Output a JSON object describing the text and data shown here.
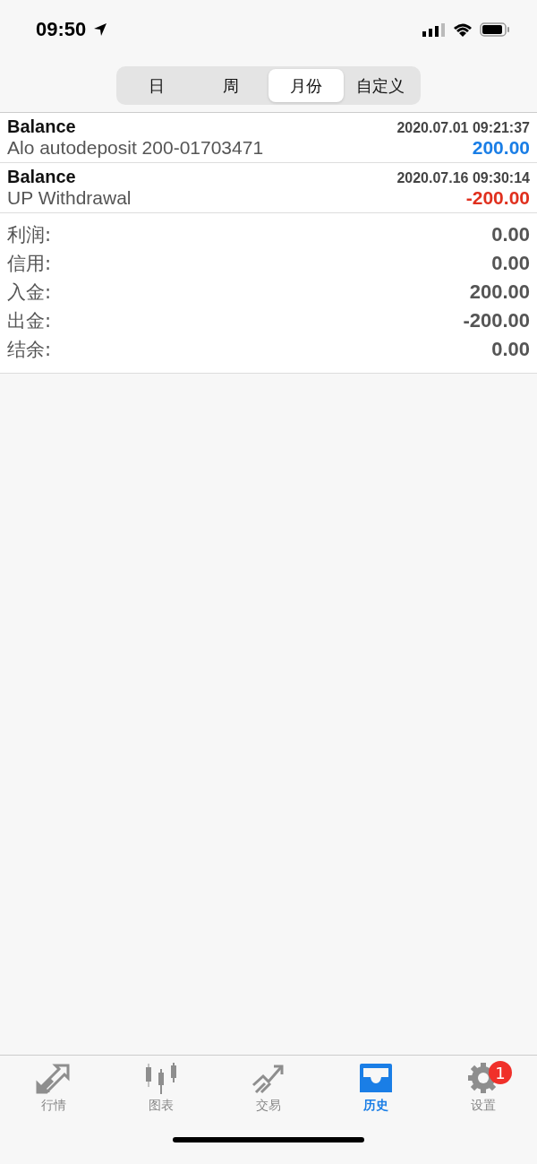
{
  "status_bar": {
    "time": "09:50"
  },
  "periods": [
    {
      "label": "日",
      "selected": false
    },
    {
      "label": "周",
      "selected": false
    },
    {
      "label": "月份",
      "selected": true
    },
    {
      "label": "自定义",
      "selected": false
    }
  ],
  "deals": [
    {
      "type": "Balance",
      "time": "2020.07.01 09:21:37",
      "comment": "Alo autodeposit 200-01703471",
      "amount": "200.00",
      "color": "#1a7ee6"
    },
    {
      "type": "Balance",
      "time": "2020.07.16 09:30:14",
      "comment": "UP Withdrawal",
      "amount": "-200.00",
      "color": "#e0301e"
    }
  ],
  "summary": [
    {
      "label": "利润:",
      "value": "0.00"
    },
    {
      "label": "信用:",
      "value": "0.00"
    },
    {
      "label": "入金:",
      "value": "200.00"
    },
    {
      "label": "出金:",
      "value": "-200.00"
    },
    {
      "label": "结余:",
      "value": "0.00"
    }
  ],
  "tab_bar": [
    {
      "kind": "quotes",
      "label": "行情",
      "selected": false
    },
    {
      "kind": "chart",
      "label": "图表",
      "selected": false
    },
    {
      "kind": "trade",
      "label": "交易",
      "selected": false
    },
    {
      "kind": "history",
      "label": "历史",
      "selected": true
    },
    {
      "kind": "settings",
      "label": "设置",
      "selected": false,
      "badge": "1"
    }
  ]
}
